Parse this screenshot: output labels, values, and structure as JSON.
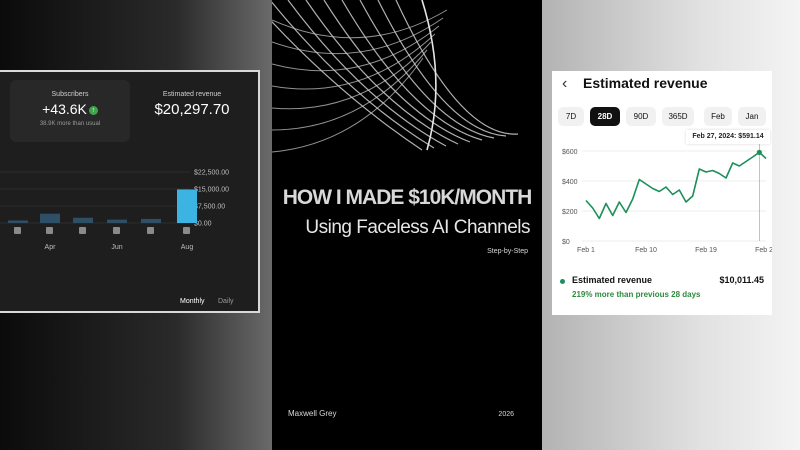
{
  "left_panel": {
    "cards": {
      "subscribers": {
        "label": "Subscribers",
        "value": "+43.6K",
        "sub": "38.9K more than usual"
      },
      "revenue": {
        "label": "Estimated revenue",
        "value": "$20,297.70"
      }
    },
    "toggle": {
      "monthly": "Monthly",
      "daily": "Daily"
    },
    "chart_data": {
      "type": "bar",
      "categories": [
        "",
        "",
        "Apr",
        "",
        "Jun",
        "",
        "Aug"
      ],
      "x_tick_labels": [
        "Apr",
        "Jun",
        "Aug"
      ],
      "values": [
        1200,
        1100,
        4100,
        2300,
        1500,
        1800,
        14800
      ],
      "ylim": [
        0,
        22500
      ],
      "y_tick_labels": [
        "$22,500.00",
        "$15,000.00",
        "$7,500.00",
        "$0.00"
      ],
      "y_ticks": [
        22500,
        15000,
        7500,
        0
      ],
      "colors": {
        "bar": "#2f4f66",
        "highlight": "#3db3e3"
      }
    }
  },
  "cover": {
    "title": "HOW I MADE $10K/MONTH",
    "subtitle": "Using Faceless AI Channels",
    "steps": "Step-by-Step",
    "author": "Maxwell Grey",
    "year": "2026"
  },
  "right_panel": {
    "title": "Estimated revenue",
    "tabs": [
      "7D",
      "28D",
      "90D",
      "365D",
      "Feb",
      "Jan"
    ],
    "active_tab": "28D",
    "tooltip": "Feb 27, 2024: $591.14",
    "legend": {
      "label": "Estimated revenue",
      "value": "$10,011.45",
      "sub": "219% more than previous 28 days"
    },
    "chart_data": {
      "type": "line",
      "x_tick_labels": [
        "Feb 1",
        "Feb 10",
        "Feb 19",
        "Feb 28"
      ],
      "y_tick_labels": [
        "$600",
        "$400",
        "$200",
        "$0"
      ],
      "y_ticks": [
        600,
        400,
        200,
        0
      ],
      "ylim": [
        0,
        650
      ],
      "x": [
        1,
        2,
        3,
        4,
        5,
        6,
        7,
        8,
        9,
        10,
        11,
        12,
        13,
        14,
        15,
        16,
        17,
        18,
        19,
        20,
        21,
        22,
        23,
        24,
        25,
        26,
        27,
        28
      ],
      "values": [
        270,
        220,
        150,
        250,
        170,
        260,
        190,
        280,
        410,
        380,
        350,
        330,
        360,
        310,
        340,
        260,
        300,
        480,
        460,
        470,
        450,
        420,
        520,
        500,
        530,
        560,
        591,
        550
      ],
      "colors": {
        "line": "#1c8f5a"
      }
    }
  }
}
